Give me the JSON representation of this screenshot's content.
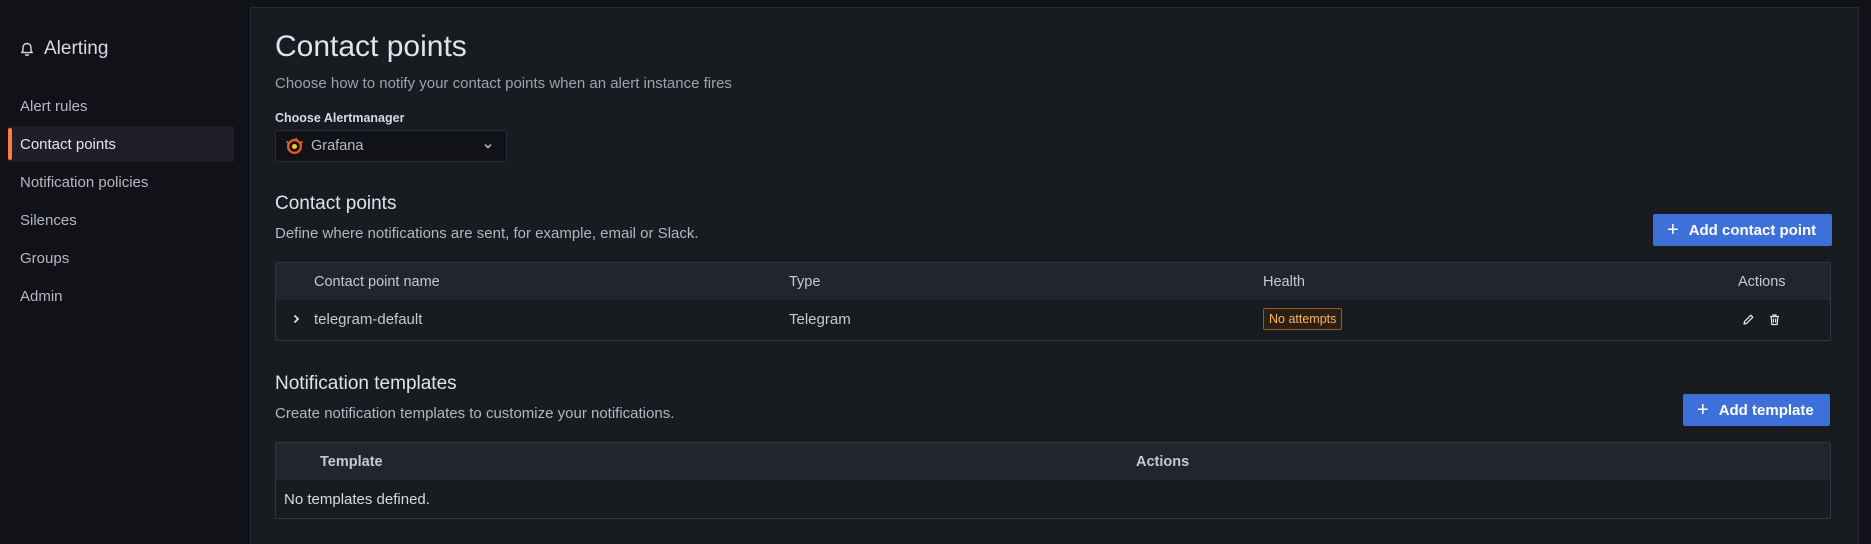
{
  "sidebar": {
    "title": "Alerting",
    "items": [
      {
        "label": "Alert rules"
      },
      {
        "label": "Contact points"
      },
      {
        "label": "Notification policies"
      },
      {
        "label": "Silences"
      },
      {
        "label": "Groups"
      },
      {
        "label": "Admin"
      }
    ],
    "active_accent": "#ff7941"
  },
  "page": {
    "title": "Contact points",
    "subtitle": "Choose how to notify your contact points when an alert instance fires"
  },
  "alertmanager": {
    "label": "Choose Alertmanager",
    "selected": "Grafana"
  },
  "contact_points": {
    "title": "Contact points",
    "description": "Define where notifications are sent, for example, email or Slack.",
    "add_button": "Add contact point",
    "columns": [
      "Contact point name",
      "Type",
      "Health",
      "Actions"
    ],
    "rows": [
      {
        "name": "telegram-default",
        "type": "Telegram",
        "health": "No attempts"
      }
    ]
  },
  "templates": {
    "title": "Notification templates",
    "description": "Create notification templates to customize your notifications.",
    "add_button": "Add template",
    "columns": [
      "Template",
      "Actions"
    ],
    "empty": "No templates defined."
  },
  "colors": {
    "primary": "#3d71d9",
    "warning": "#ffb55a"
  }
}
